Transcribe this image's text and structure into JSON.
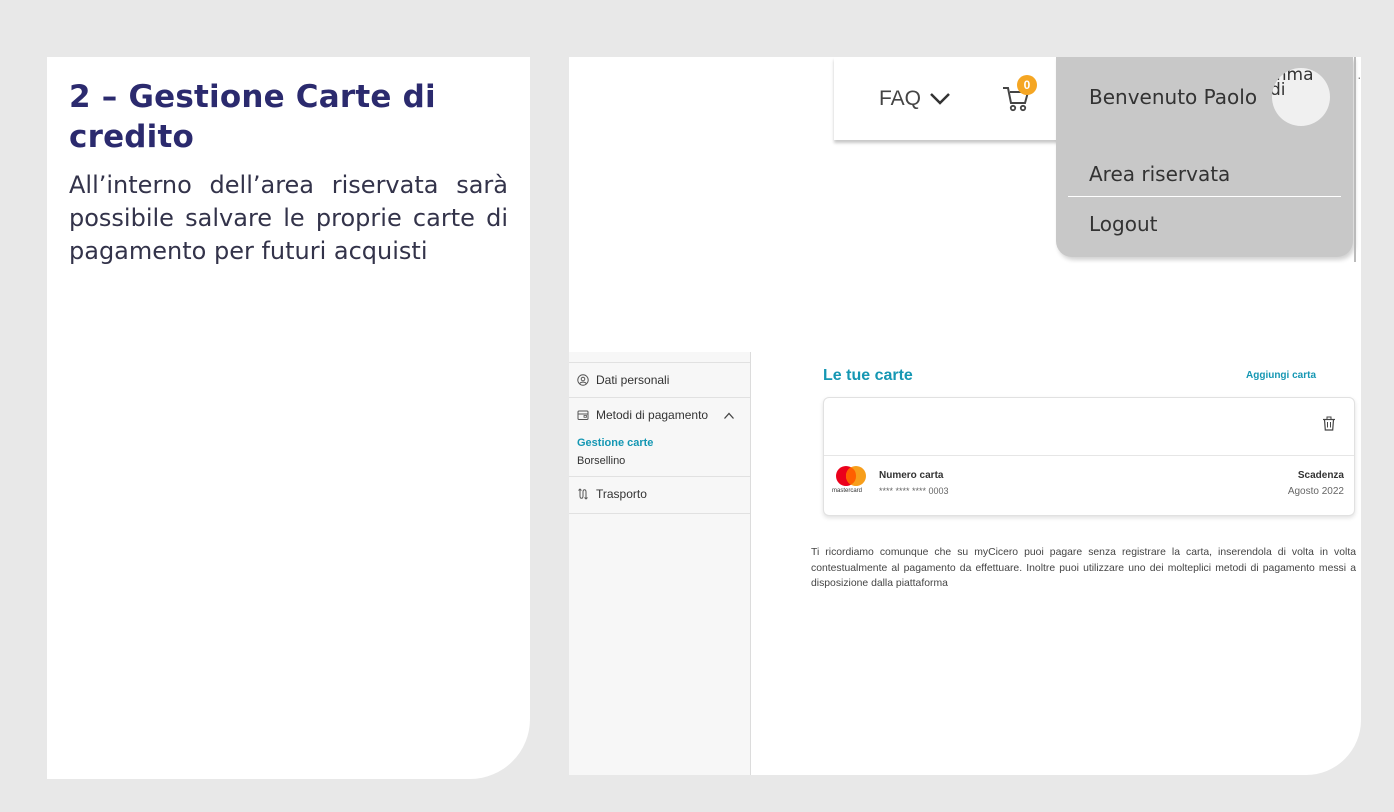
{
  "slide": {
    "title": "2 – Gestione Carte di credito",
    "description": "All’interno dell’area riservata sarà possibile salvare le proprie carte di pagamento per futuri acquisti"
  },
  "header": {
    "faq_label": "FAQ",
    "cart_count": "0",
    "welcome": "Benvenuto Paolo",
    "avatar_text": "mma di"
  },
  "user_menu": {
    "items": [
      {
        "label": "Area riservata"
      },
      {
        "label": "Logout"
      }
    ]
  },
  "sidebar": {
    "items": [
      {
        "label": "Dati personali",
        "icon": "user-circle-icon"
      },
      {
        "label": "Metodi di pagamento",
        "icon": "wallet-icon"
      },
      {
        "label": "Trasporto",
        "icon": "route-icon"
      }
    ],
    "sub_items": [
      {
        "label": "Gestione carte",
        "active": true
      },
      {
        "label": "Borsellino",
        "active": false
      }
    ]
  },
  "main": {
    "title": "Le tue carte",
    "add_card_label": "Aggiungi carta",
    "card": {
      "brand": "mastercard",
      "number_label": "Numero carta",
      "number_value": "**** **** **** 0003",
      "expiry_label": "Scadenza",
      "expiry_value": "Agosto 2022"
    },
    "info_text": "Ti ricordiamo comunque che su myCicero puoi pagare senza registrare la carta, inserendola di volta in volta contestualmente al pagamento da effettuare. Inoltre puoi utilizzare uno dei molteplici metodi di pagamento messi a disposizione dalla piattaforma"
  },
  "colors": {
    "slide_title": "#2b2a6e",
    "accent": "#1597b3",
    "badge": "#f5a623",
    "menu_bg": "#c8c8c8",
    "page_bg": "#e8e8e8"
  }
}
